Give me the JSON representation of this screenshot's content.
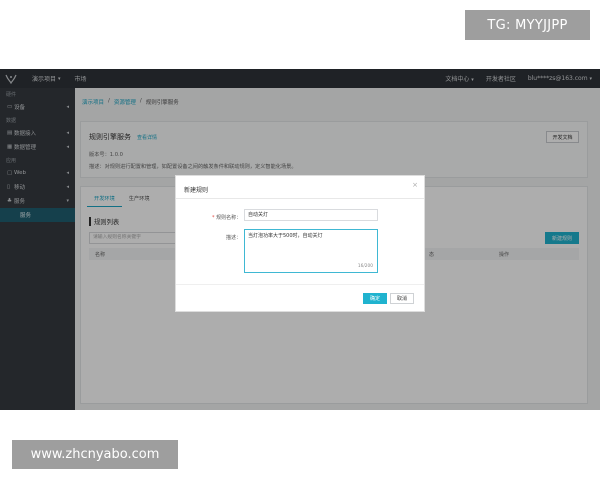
{
  "watermarks": {
    "top": "TG: MYYJJPP",
    "bottom": "www.zhcnyabo.com"
  },
  "topbar": {
    "project": "演示项目",
    "market": "市场",
    "docs": "文档中心",
    "community": "开发者社区",
    "user": "blu****zs@163.com"
  },
  "sidebar": {
    "groups": [
      "硬件",
      "数据",
      "应用"
    ],
    "items": [
      {
        "label": "设备",
        "icon": "device-icon"
      },
      {
        "label": "数据接入",
        "icon": "data-access-icon"
      },
      {
        "label": "数据管理",
        "icon": "data-manage-icon"
      },
      {
        "label": "Web",
        "icon": "web-icon"
      },
      {
        "label": "移动",
        "icon": "mobile-icon"
      },
      {
        "label": "服务",
        "icon": "service-icon"
      }
    ],
    "sub_item": "服务"
  },
  "breadcrumb": {
    "a": "演示项目",
    "b": "资源管理",
    "c": "规则引擎服务",
    "sep": "/"
  },
  "service": {
    "title": "规则引擎服务",
    "link": "查看详情",
    "dev_doc": "开发文档",
    "version": "版本号：1.0.0",
    "desc": "描述：对规则进行配置和管理，如配置设备之间的触发条件和联动规则，定义智能化场景。"
  },
  "tabs": [
    "开发环境",
    "生产环境"
  ],
  "list": {
    "title": "规则列表",
    "search_placeholder": "请输入规则名称关键字",
    "search_btn": "搜",
    "new_btn": "新建规则",
    "columns": [
      "名称",
      "",
      "态",
      "操作"
    ]
  },
  "dialog": {
    "title": "新建规则",
    "close": "×",
    "name_label": "规则名称：",
    "name_value": "自动关灯",
    "desc_label": "描述：",
    "desc_value": "当灯泡功率大于500时，自动关灯",
    "counter": "16/200",
    "ok": "确定",
    "cancel": "取消"
  },
  "colors": {
    "accent": "#20b3cf",
    "topbar": "#2f3338",
    "sidebar": "#353a40"
  }
}
